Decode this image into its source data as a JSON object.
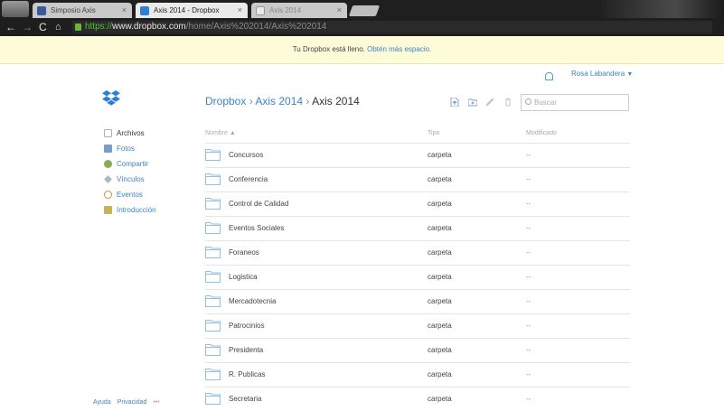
{
  "browser": {
    "tabs": [
      {
        "title": "Simposio Axis"
      },
      {
        "title": "Axis 2014 - Dropbox"
      },
      {
        "title": "Axis 2014"
      }
    ],
    "url": {
      "scheme": "https://",
      "domain": "www.dropbox.com",
      "path": "/home/Axis%202014/Axis%202014"
    }
  },
  "notice": {
    "text": "Tu Dropbox está lleno. ",
    "link": "Obtén más espacio."
  },
  "user": {
    "name": "Rosa Labandera"
  },
  "breadcrumb": {
    "root": "Dropbox",
    "sep1": "›",
    "level1": "Axis 2014",
    "sep2": "›",
    "current": "Axis 2014"
  },
  "search": {
    "placeholder": "Buscar"
  },
  "sidebar": {
    "items": [
      {
        "label": "Archivos",
        "icon": "file-icon",
        "color": "#b0b0b0"
      },
      {
        "label": "Fotos",
        "icon": "photo-icon",
        "color": "#7a9cc8"
      },
      {
        "label": "Compartir",
        "icon": "share-icon",
        "color": "#8aab54"
      },
      {
        "label": "Vínculos",
        "icon": "link-icon",
        "color": "#a8b8c8"
      },
      {
        "label": "Eventos",
        "icon": "events-icon",
        "color": "#e0893a"
      },
      {
        "label": "Introducción",
        "icon": "intro-icon",
        "color": "#c9b25a"
      }
    ]
  },
  "footer": {
    "help": "Ayuda",
    "privacy": "Privacidad",
    "more": "•••"
  },
  "table": {
    "headers": {
      "name": "Nombre ▲",
      "type": "Tipo",
      "modified": "Modificado"
    },
    "rows": [
      {
        "name": "Concursos",
        "type": "carpeta",
        "modified": "--"
      },
      {
        "name": "Conferencia",
        "type": "carpeta",
        "modified": "--"
      },
      {
        "name": "Control de Calidad",
        "type": "carpeta",
        "modified": "--"
      },
      {
        "name": "Eventos Sociales",
        "type": "carpeta",
        "modified": "--"
      },
      {
        "name": "Foraneos",
        "type": "carpeta",
        "modified": "--"
      },
      {
        "name": "Logistica",
        "type": "carpeta",
        "modified": "--"
      },
      {
        "name": "Mercadotecnia",
        "type": "carpeta",
        "modified": "--"
      },
      {
        "name": "Patrocinios",
        "type": "carpeta",
        "modified": "--"
      },
      {
        "name": "Presidenta",
        "type": "carpeta",
        "modified": "--"
      },
      {
        "name": "R. Publicas",
        "type": "carpeta",
        "modified": "--"
      },
      {
        "name": "Secretaria",
        "type": "carpeta",
        "modified": "--"
      }
    ]
  },
  "colors": {
    "accent": "#3d84c6",
    "notice_bg": "#fdfbd8",
    "folder": "#8fc1e8"
  }
}
